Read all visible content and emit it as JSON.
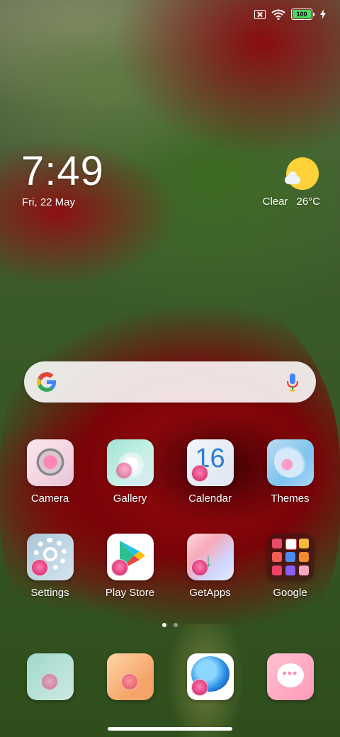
{
  "status_bar": {
    "battery_level": "100",
    "icons": [
      "sim-x-icon",
      "wifi-icon",
      "battery-icon",
      "charging-bolt-icon"
    ],
    "battery_color": "#4cd964"
  },
  "clock": {
    "time": "7:49",
    "date": "Fri, 22 May"
  },
  "weather": {
    "condition": "Clear",
    "temperature": "26°C",
    "icon": "sun-cloud-icon"
  },
  "search": {
    "icons": [
      "google-g-icon",
      "microphone-icon"
    ]
  },
  "apps_row1": [
    {
      "label": "Camera",
      "icon": "camera-icon"
    },
    {
      "label": "Gallery",
      "icon": "gallery-icon"
    },
    {
      "label": "Calendar",
      "icon": "calendar-icon",
      "day": "16"
    },
    {
      "label": "Themes",
      "icon": "themes-icon"
    }
  ],
  "apps_row2": [
    {
      "label": "Settings",
      "icon": "settings-icon"
    },
    {
      "label": "Play Store",
      "icon": "play-store-icon"
    },
    {
      "label": "GetApps",
      "icon": "getapps-icon"
    },
    {
      "label": "Google",
      "icon": "google-folder-icon"
    }
  ],
  "page_indicator": {
    "pages": 2,
    "active": 1
  },
  "dock": [
    {
      "icon": "contacts-icon"
    },
    {
      "icon": "notes-icon"
    },
    {
      "icon": "browser-icon"
    },
    {
      "icon": "messages-icon"
    }
  ]
}
